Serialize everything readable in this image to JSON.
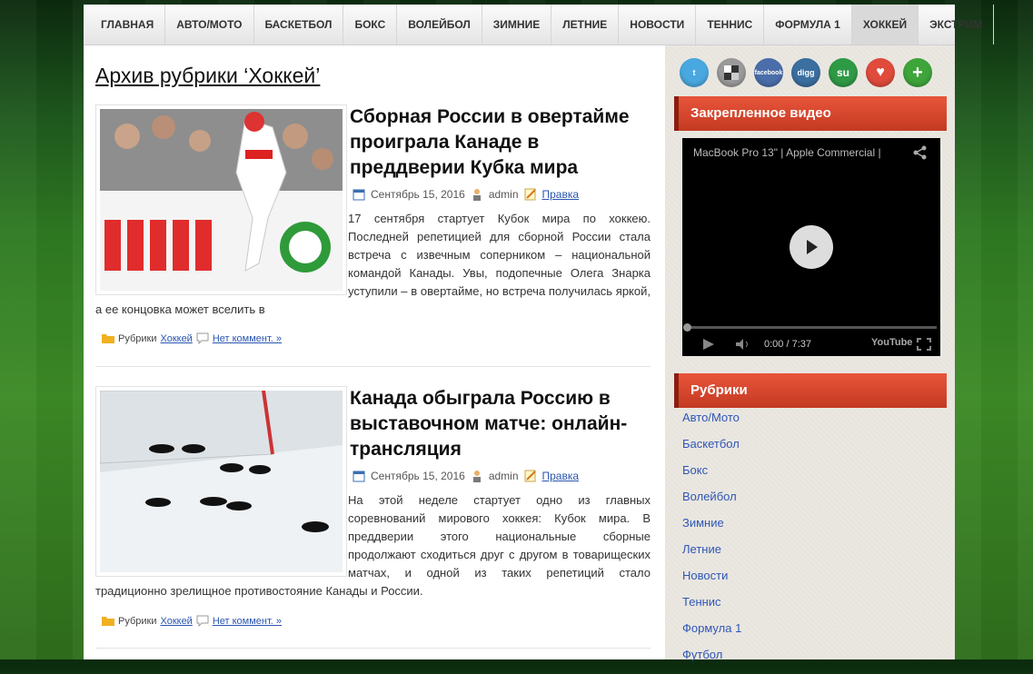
{
  "nav": {
    "items": [
      "Главная",
      "Авто/Мото",
      "Баскетбол",
      "Бокс",
      "Волейбол",
      "Зимние",
      "Летние",
      "Новости",
      "Теннис",
      "Формула 1",
      "Хоккей",
      "Экстрим"
    ],
    "active": "Хоккей"
  },
  "archive": {
    "title": "Архив рубрики ‘Хоккей’"
  },
  "posts": [
    {
      "title": "Сборная России в овертайме проиграла Канаде в преддверии Кубка мира",
      "date": "Сентябрь 15, 2016",
      "author": "admin",
      "edit": "Правка",
      "excerpt": "17 сентября стартует Кубок мира по хоккею. Последней репетицией для сборной России стала встреча с извечным соперником – национальной командой Канады. Увы, подопечные Олега Знарка уступили – в овертайме, но встреча получилась яркой, а ее концовка может вселить в",
      "category_label": "Рубрики",
      "category": "Хоккей",
      "comments": "Нет коммент. »"
    },
    {
      "title": "Канада обыграла Россию в выставочном матче: онлайн-трансляция",
      "date": "Сентябрь 15, 2016",
      "author": "admin",
      "edit": "Правка",
      "excerpt": "На этой неделе стартует одно из главных соревнований мирового хоккея: Кубок мира. В преддверии этого национальные сборные продолжают сходиться друг с другом в товарищеских матчах, и одной из таких репетиций стало традиционно зрелищное противостояние Канады и России.",
      "category_label": "Рубрики",
      "category": "Хоккей",
      "comments": "Нет коммент. »"
    }
  ],
  "sidebar": {
    "social": [
      {
        "icon": "twitter-icon",
        "color": "#4aa8e0",
        "label": "t"
      },
      {
        "icon": "delicious-icon",
        "color": "#9a9a9a",
        "label": ""
      },
      {
        "icon": "facebook-icon",
        "color": "#4a6ea9",
        "label": "facebook"
      },
      {
        "icon": "digg-icon",
        "color": "#3a6fa0",
        "label": "digg"
      },
      {
        "icon": "stumbleupon-icon",
        "color": "#2f9a45",
        "label": "su"
      },
      {
        "icon": "heart-icon",
        "color": "#e04b3c",
        "label": "♥"
      },
      {
        "icon": "add-icon",
        "color": "#3ea53a",
        "label": "+"
      }
    ],
    "video_widget_title": "Закрепленное видео",
    "video": {
      "title": "MacBook Pro 13\" | Apple Commercial |",
      "time": "0:00 / 7:37",
      "brand": "YouTube"
    },
    "categories_title": "Рубрики",
    "categories": [
      "Авто/Мото",
      "Баскетбол",
      "Бокс",
      "Волейбол",
      "Зимние",
      "Летние",
      "Новости",
      "Теннис",
      "Формула 1",
      "Футбол"
    ]
  }
}
